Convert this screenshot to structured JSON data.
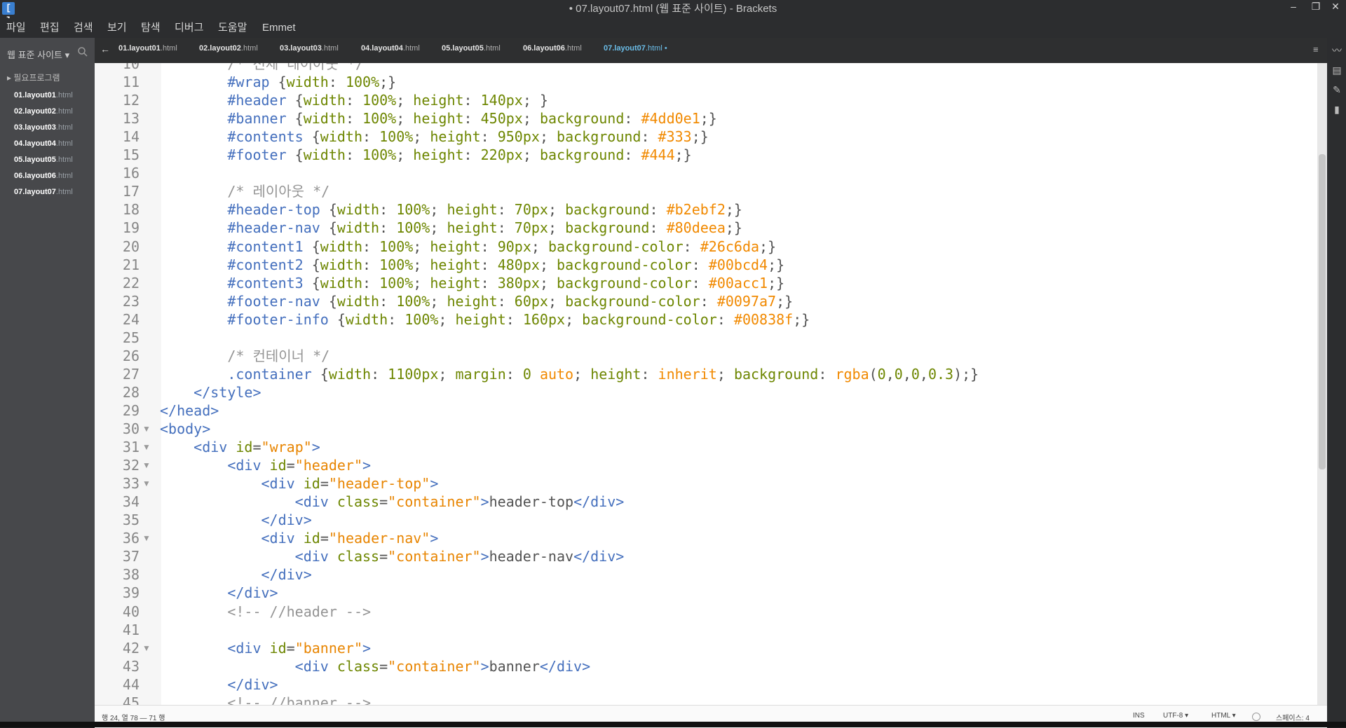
{
  "window": {
    "title": "• 07.layout07.html (웹 표준 사이트) - Brackets",
    "app_icon": "[ ]",
    "minimize": "–",
    "restore": "❐",
    "close": "✕"
  },
  "menu": [
    "파일",
    "편집",
    "검색",
    "보기",
    "탐색",
    "디버그",
    "도움말",
    "Emmet"
  ],
  "sidebar": {
    "project": "웹 표준 사이트 ▾",
    "folder": "▸ 필요프로그램",
    "files": [
      {
        "name": "01.layout01",
        "ext": ".html"
      },
      {
        "name": "02.layout02",
        "ext": ".html"
      },
      {
        "name": "03.layout03",
        "ext": ".html"
      },
      {
        "name": "04.layout04",
        "ext": ".html"
      },
      {
        "name": "05.layout05",
        "ext": ".html"
      },
      {
        "name": "06.layout06",
        "ext": ".html"
      },
      {
        "name": "07.layout07",
        "ext": ".html"
      }
    ]
  },
  "tabs": [
    {
      "name": "01.layout01",
      "ext": ".html"
    },
    {
      "name": "02.layout02",
      "ext": ".html"
    },
    {
      "name": "03.layout03",
      "ext": ".html"
    },
    {
      "name": "04.layout04",
      "ext": ".html"
    },
    {
      "name": "05.layout05",
      "ext": ".html"
    },
    {
      "name": "06.layout06",
      "ext": ".html"
    },
    {
      "name": "07.layout07",
      "ext": ".html •"
    }
  ],
  "tab_back": "←",
  "tab_menu": "≡",
  "code_lines": [
    {
      "n": "10",
      "segs": [
        [
          "c-cmt",
          "        /* 전체 레이아웃 */"
        ]
      ]
    },
    {
      "n": "11",
      "segs": [
        [
          "",
          "        "
        ],
        [
          "c-sel",
          "#wrap"
        ],
        [
          "",
          " {"
        ],
        [
          "c-prop",
          "width"
        ],
        [
          "",
          ": "
        ],
        [
          "c-num",
          "100%"
        ],
        [
          "",
          ";}"
        ]
      ]
    },
    {
      "n": "12",
      "segs": [
        [
          "",
          "        "
        ],
        [
          "c-sel",
          "#header"
        ],
        [
          "",
          " {"
        ],
        [
          "c-prop",
          "width"
        ],
        [
          "",
          ": "
        ],
        [
          "c-num",
          "100%"
        ],
        [
          "",
          "; "
        ],
        [
          "c-prop",
          "height"
        ],
        [
          "",
          ": "
        ],
        [
          "c-num",
          "140px"
        ],
        [
          "",
          "; }"
        ]
      ]
    },
    {
      "n": "13",
      "segs": [
        [
          "",
          "        "
        ],
        [
          "c-sel",
          "#banner"
        ],
        [
          "",
          " {"
        ],
        [
          "c-prop",
          "width"
        ],
        [
          "",
          ": "
        ],
        [
          "c-num",
          "100%"
        ],
        [
          "",
          "; "
        ],
        [
          "c-prop",
          "height"
        ],
        [
          "",
          ": "
        ],
        [
          "c-num",
          "450px"
        ],
        [
          "",
          "; "
        ],
        [
          "c-prop",
          "background"
        ],
        [
          "",
          ": "
        ],
        [
          "c-val",
          "#4dd0e1"
        ],
        [
          "",
          ";}"
        ]
      ]
    },
    {
      "n": "14",
      "segs": [
        [
          "",
          "        "
        ],
        [
          "c-sel",
          "#contents"
        ],
        [
          "",
          " {"
        ],
        [
          "c-prop",
          "width"
        ],
        [
          "",
          ": "
        ],
        [
          "c-num",
          "100%"
        ],
        [
          "",
          "; "
        ],
        [
          "c-prop",
          "height"
        ],
        [
          "",
          ": "
        ],
        [
          "c-num",
          "950px"
        ],
        [
          "",
          "; "
        ],
        [
          "c-prop",
          "background"
        ],
        [
          "",
          ": "
        ],
        [
          "c-val",
          "#333"
        ],
        [
          "",
          ";}"
        ]
      ]
    },
    {
      "n": "15",
      "segs": [
        [
          "",
          "        "
        ],
        [
          "c-sel",
          "#footer"
        ],
        [
          "",
          " {"
        ],
        [
          "c-prop",
          "width"
        ],
        [
          "",
          ": "
        ],
        [
          "c-num",
          "100%"
        ],
        [
          "",
          "; "
        ],
        [
          "c-prop",
          "height"
        ],
        [
          "",
          ": "
        ],
        [
          "c-num",
          "220px"
        ],
        [
          "",
          "; "
        ],
        [
          "c-prop",
          "background"
        ],
        [
          "",
          ": "
        ],
        [
          "c-val",
          "#444"
        ],
        [
          "",
          ";}"
        ]
      ]
    },
    {
      "n": "16",
      "segs": [
        [
          "",
          ""
        ]
      ]
    },
    {
      "n": "17",
      "segs": [
        [
          "c-cmt",
          "        /* 레이아웃 */"
        ]
      ]
    },
    {
      "n": "18",
      "segs": [
        [
          "",
          "        "
        ],
        [
          "c-sel",
          "#header-top"
        ],
        [
          "",
          " {"
        ],
        [
          "c-prop",
          "width"
        ],
        [
          "",
          ": "
        ],
        [
          "c-num",
          "100%"
        ],
        [
          "",
          "; "
        ],
        [
          "c-prop",
          "height"
        ],
        [
          "",
          ": "
        ],
        [
          "c-num",
          "70px"
        ],
        [
          "",
          "; "
        ],
        [
          "c-prop",
          "background"
        ],
        [
          "",
          ": "
        ],
        [
          "c-val",
          "#b2ebf2"
        ],
        [
          "",
          ";}"
        ]
      ]
    },
    {
      "n": "19",
      "segs": [
        [
          "",
          "        "
        ],
        [
          "c-sel",
          "#header-nav"
        ],
        [
          "",
          " {"
        ],
        [
          "c-prop",
          "width"
        ],
        [
          "",
          ": "
        ],
        [
          "c-num",
          "100%"
        ],
        [
          "",
          "; "
        ],
        [
          "c-prop",
          "height"
        ],
        [
          "",
          ": "
        ],
        [
          "c-num",
          "70px"
        ],
        [
          "",
          "; "
        ],
        [
          "c-prop",
          "background"
        ],
        [
          "",
          ": "
        ],
        [
          "c-val",
          "#80deea"
        ],
        [
          "",
          ";}"
        ]
      ]
    },
    {
      "n": "20",
      "segs": [
        [
          "",
          "        "
        ],
        [
          "c-sel",
          "#content1"
        ],
        [
          "",
          " {"
        ],
        [
          "c-prop",
          "width"
        ],
        [
          "",
          ": "
        ],
        [
          "c-num",
          "100%"
        ],
        [
          "",
          "; "
        ],
        [
          "c-prop",
          "height"
        ],
        [
          "",
          ": "
        ],
        [
          "c-num",
          "90px"
        ],
        [
          "",
          "; "
        ],
        [
          "c-prop",
          "background-color"
        ],
        [
          "",
          ": "
        ],
        [
          "c-val",
          "#26c6da"
        ],
        [
          "",
          ";}"
        ]
      ]
    },
    {
      "n": "21",
      "segs": [
        [
          "",
          "        "
        ],
        [
          "c-sel",
          "#content2"
        ],
        [
          "",
          " {"
        ],
        [
          "c-prop",
          "width"
        ],
        [
          "",
          ": "
        ],
        [
          "c-num",
          "100%"
        ],
        [
          "",
          "; "
        ],
        [
          "c-prop",
          "height"
        ],
        [
          "",
          ": "
        ],
        [
          "c-num",
          "480px"
        ],
        [
          "",
          "; "
        ],
        [
          "c-prop",
          "background-color"
        ],
        [
          "",
          ": "
        ],
        [
          "c-val",
          "#00bcd4"
        ],
        [
          "",
          ";}"
        ]
      ]
    },
    {
      "n": "22",
      "segs": [
        [
          "",
          "        "
        ],
        [
          "c-sel",
          "#content3"
        ],
        [
          "",
          " {"
        ],
        [
          "c-prop",
          "width"
        ],
        [
          "",
          ": "
        ],
        [
          "c-num",
          "100%"
        ],
        [
          "",
          "; "
        ],
        [
          "c-prop",
          "height"
        ],
        [
          "",
          ": "
        ],
        [
          "c-num",
          "380px"
        ],
        [
          "",
          "; "
        ],
        [
          "c-prop",
          "background-color"
        ],
        [
          "",
          ": "
        ],
        [
          "c-val",
          "#00acc1"
        ],
        [
          "",
          ";}"
        ]
      ]
    },
    {
      "n": "23",
      "segs": [
        [
          "",
          "        "
        ],
        [
          "c-sel",
          "#footer-nav"
        ],
        [
          "",
          " {"
        ],
        [
          "c-prop",
          "width"
        ],
        [
          "",
          ": "
        ],
        [
          "c-num",
          "100%"
        ],
        [
          "",
          "; "
        ],
        [
          "c-prop",
          "height"
        ],
        [
          "",
          ": "
        ],
        [
          "c-num",
          "60px"
        ],
        [
          "",
          "; "
        ],
        [
          "c-prop",
          "background-color"
        ],
        [
          "",
          ": "
        ],
        [
          "c-val",
          "#0097a7"
        ],
        [
          "",
          ";}"
        ]
      ]
    },
    {
      "n": "24",
      "segs": [
        [
          "",
          "        "
        ],
        [
          "c-sel",
          "#footer-info"
        ],
        [
          "",
          " {"
        ],
        [
          "c-prop",
          "width"
        ],
        [
          "",
          ": "
        ],
        [
          "c-num",
          "100%"
        ],
        [
          "",
          "; "
        ],
        [
          "c-prop",
          "height"
        ],
        [
          "",
          ": "
        ],
        [
          "c-num",
          "160px"
        ],
        [
          "",
          "; "
        ],
        [
          "c-prop",
          "background-color"
        ],
        [
          "",
          ": "
        ],
        [
          "c-val",
          "#00838f"
        ],
        [
          "",
          ";}"
        ]
      ]
    },
    {
      "n": "25",
      "segs": [
        [
          "",
          ""
        ]
      ]
    },
    {
      "n": "26",
      "segs": [
        [
          "c-cmt",
          "        /* 컨테이너 */"
        ]
      ]
    },
    {
      "n": "27",
      "segs": [
        [
          "",
          "        "
        ],
        [
          "c-sel",
          ".container"
        ],
        [
          "",
          " {"
        ],
        [
          "c-prop",
          "width"
        ],
        [
          "",
          ": "
        ],
        [
          "c-num",
          "1100px"
        ],
        [
          "",
          "; "
        ],
        [
          "c-prop",
          "margin"
        ],
        [
          "",
          ": "
        ],
        [
          "c-num",
          "0"
        ],
        [
          "",
          " "
        ],
        [
          "c-val",
          "auto"
        ],
        [
          "",
          "; "
        ],
        [
          "c-prop",
          "height"
        ],
        [
          "",
          ": "
        ],
        [
          "c-val",
          "inherit"
        ],
        [
          "",
          "; "
        ],
        [
          "c-prop",
          "background"
        ],
        [
          "",
          ": "
        ],
        [
          "c-val",
          "rgba"
        ],
        [
          "",
          "("
        ],
        [
          "c-num",
          "0"
        ],
        [
          "",
          ","
        ],
        [
          "c-num",
          "0"
        ],
        [
          "",
          ","
        ],
        [
          "c-num",
          "0"
        ],
        [
          "",
          ","
        ],
        [
          "c-num",
          "0.3"
        ],
        [
          "",
          ");}"
        ]
      ]
    },
    {
      "n": "28",
      "segs": [
        [
          "",
          "    "
        ],
        [
          "c-tag",
          "</style>"
        ]
      ]
    },
    {
      "n": "29",
      "segs": [
        [
          "c-tag",
          "</head>"
        ]
      ]
    },
    {
      "n": "30",
      "fold": "▼",
      "segs": [
        [
          "c-tag",
          "<body>"
        ]
      ]
    },
    {
      "n": "31",
      "fold": "▼",
      "segs": [
        [
          "",
          "    "
        ],
        [
          "c-tag",
          "<div "
        ],
        [
          "c-attr",
          "id"
        ],
        [
          "",
          "="
        ],
        [
          "c-str",
          "\"wrap\""
        ],
        [
          "c-tag",
          ">"
        ]
      ]
    },
    {
      "n": "32",
      "fold": "▼",
      "segs": [
        [
          "",
          "        "
        ],
        [
          "c-tag",
          "<div "
        ],
        [
          "c-attr",
          "id"
        ],
        [
          "",
          "="
        ],
        [
          "c-str",
          "\"header\""
        ],
        [
          "c-tag",
          ">"
        ]
      ]
    },
    {
      "n": "33",
      "fold": "▼",
      "segs": [
        [
          "",
          "            "
        ],
        [
          "c-tag",
          "<div "
        ],
        [
          "c-attr",
          "id"
        ],
        [
          "",
          "="
        ],
        [
          "c-str",
          "\"header-top\""
        ],
        [
          "c-tag",
          ">"
        ]
      ]
    },
    {
      "n": "34",
      "segs": [
        [
          "",
          "                "
        ],
        [
          "c-tag",
          "<div "
        ],
        [
          "c-attr",
          "class"
        ],
        [
          "",
          "="
        ],
        [
          "c-str",
          "\"container\""
        ],
        [
          "c-tag",
          ">"
        ],
        [
          "c-txt",
          "header-top"
        ],
        [
          "c-tag",
          "</div>"
        ]
      ]
    },
    {
      "n": "35",
      "segs": [
        [
          "",
          "            "
        ],
        [
          "c-tag",
          "</div>"
        ]
      ]
    },
    {
      "n": "36",
      "fold": "▼",
      "segs": [
        [
          "",
          "            "
        ],
        [
          "c-tag",
          "<div "
        ],
        [
          "c-attr",
          "id"
        ],
        [
          "",
          "="
        ],
        [
          "c-str",
          "\"header-nav\""
        ],
        [
          "c-tag",
          ">"
        ]
      ]
    },
    {
      "n": "37",
      "segs": [
        [
          "",
          "                "
        ],
        [
          "c-tag",
          "<div "
        ],
        [
          "c-attr",
          "class"
        ],
        [
          "",
          "="
        ],
        [
          "c-str",
          "\"container\""
        ],
        [
          "c-tag",
          ">"
        ],
        [
          "c-txt",
          "header-nav"
        ],
        [
          "c-tag",
          "</div>"
        ]
      ]
    },
    {
      "n": "38",
      "segs": [
        [
          "",
          "            "
        ],
        [
          "c-tag",
          "</div>"
        ]
      ]
    },
    {
      "n": "39",
      "segs": [
        [
          "",
          "        "
        ],
        [
          "c-tag",
          "</div>"
        ]
      ]
    },
    {
      "n": "40",
      "segs": [
        [
          "",
          "        "
        ],
        [
          "c-cmt",
          "<!-- //header -->"
        ]
      ]
    },
    {
      "n": "41",
      "segs": [
        [
          "",
          ""
        ]
      ]
    },
    {
      "n": "42",
      "fold": "▼",
      "segs": [
        [
          "",
          "        "
        ],
        [
          "c-tag",
          "<div "
        ],
        [
          "c-attr",
          "id"
        ],
        [
          "",
          "="
        ],
        [
          "c-str",
          "\"banner\""
        ],
        [
          "c-tag",
          ">"
        ]
      ]
    },
    {
      "n": "43",
      "segs": [
        [
          "",
          "                "
        ],
        [
          "c-tag",
          "<div "
        ],
        [
          "c-attr",
          "class"
        ],
        [
          "",
          "="
        ],
        [
          "c-str",
          "\"container\""
        ],
        [
          "c-tag",
          ">"
        ],
        [
          "c-txt",
          "banner"
        ],
        [
          "c-tag",
          "</div>"
        ]
      ]
    },
    {
      "n": "44",
      "segs": [
        [
          "",
          "        "
        ],
        [
          "c-tag",
          "</div>"
        ]
      ]
    },
    {
      "n": "45",
      "segs": [
        [
          "",
          "        "
        ],
        [
          "c-cmt",
          "<!-- //banner -->"
        ]
      ]
    }
  ],
  "status": {
    "cursor": "행 24, 열 78 — 71 행",
    "mode": "INS",
    "encoding": "UTF-8 ▾",
    "language": "HTML ▾",
    "indent": "스페이스: 4"
  },
  "right_toolbar_icons": [
    "live-preview-icon",
    "extension-manager-icon",
    "beautify-icon",
    "file-icon"
  ]
}
